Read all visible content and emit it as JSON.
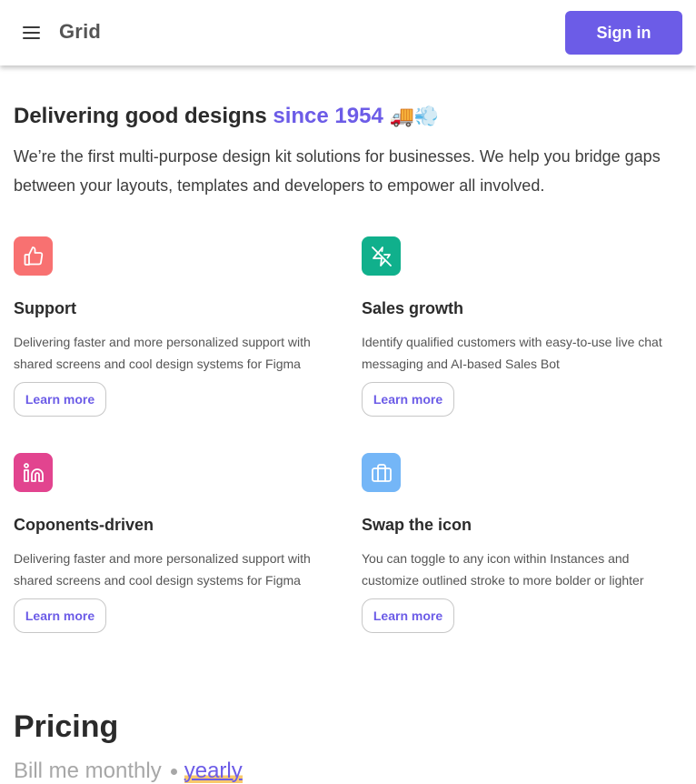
{
  "header": {
    "brand": "Grid",
    "sign_in_label": "Sign in"
  },
  "hero": {
    "title_prefix": "Delivering good designs ",
    "title_accent": "since 1954",
    "title_emoji": "🚚💨",
    "description": "We’re the first multi-purpose design kit solutions for businesses. We help you bridge gaps between your layouts, templates and developers to empower all involved."
  },
  "features": [
    {
      "icon": "thumbs-up-icon",
      "icon_color": "#f87171",
      "title": "Support",
      "description": "Delivering faster and more personalized support with shared screens and cool design systems for Figma",
      "button_label": "Learn more"
    },
    {
      "icon": "zap-off-icon",
      "icon_color": "#10b08c",
      "title": "Sales growth",
      "description": "Identify qualified customers with easy-to-use live chat messaging and AI-based Sales Bot",
      "button_label": "Learn more"
    },
    {
      "icon": "linkedin-icon",
      "icon_color": "#e2448f",
      "title": "Coponents-driven",
      "description": "Delivering faster and more personalized support with shared screens and cool design systems for Figma",
      "button_label": "Learn more"
    },
    {
      "icon": "briefcase-icon",
      "icon_color": "#74b6f7",
      "title": "Swap the icon",
      "description": "You can toggle to any icon within Instances and customize outlined stroke to more bolder or lighter",
      "button_label": "Learn more"
    }
  ],
  "pricing": {
    "title": "Pricing",
    "monthly_label": "Bill me monthly",
    "yearly_label": "yearly"
  },
  "colors": {
    "accent": "#6c5ce7",
    "highlight": "#f9c96b"
  }
}
